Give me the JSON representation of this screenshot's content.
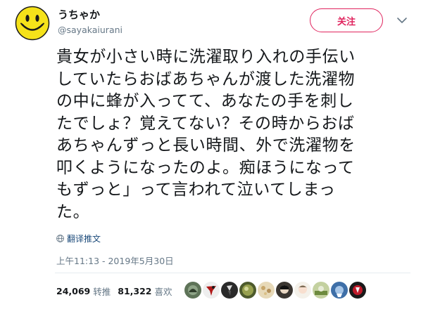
{
  "user": {
    "display_name": "うちゃか",
    "handle": "@sayakaiurani",
    "avatar_icon": "smiley-face-icon"
  },
  "follow_label": "关注",
  "tweet": {
    "lines": [
      "貴女が小さい時に洗濯取り入れの手伝い",
      "していたらおばあちゃんが渡した洗濯物",
      "の中に蜂が入ってて、あなたの手を刺し",
      "たでしょ？覚えてない？その時からおば",
      "あちゃんずっと長い時間、外で洗濯物を",
      "叩くようになったのよ。痴ほうになって",
      "もずっと」って言われて泣いてしまっ",
      "た。"
    ]
  },
  "translate_label": "翻译推文",
  "timestamp": "上午11:13 - 2019年5月30日",
  "stats": {
    "retweets": "24,069",
    "retweets_label": "转推",
    "likes": "81,322",
    "likes_label": "喜欢"
  },
  "colors": {
    "accent": "#e0245e",
    "muted": "#657786",
    "text": "#14171a"
  }
}
